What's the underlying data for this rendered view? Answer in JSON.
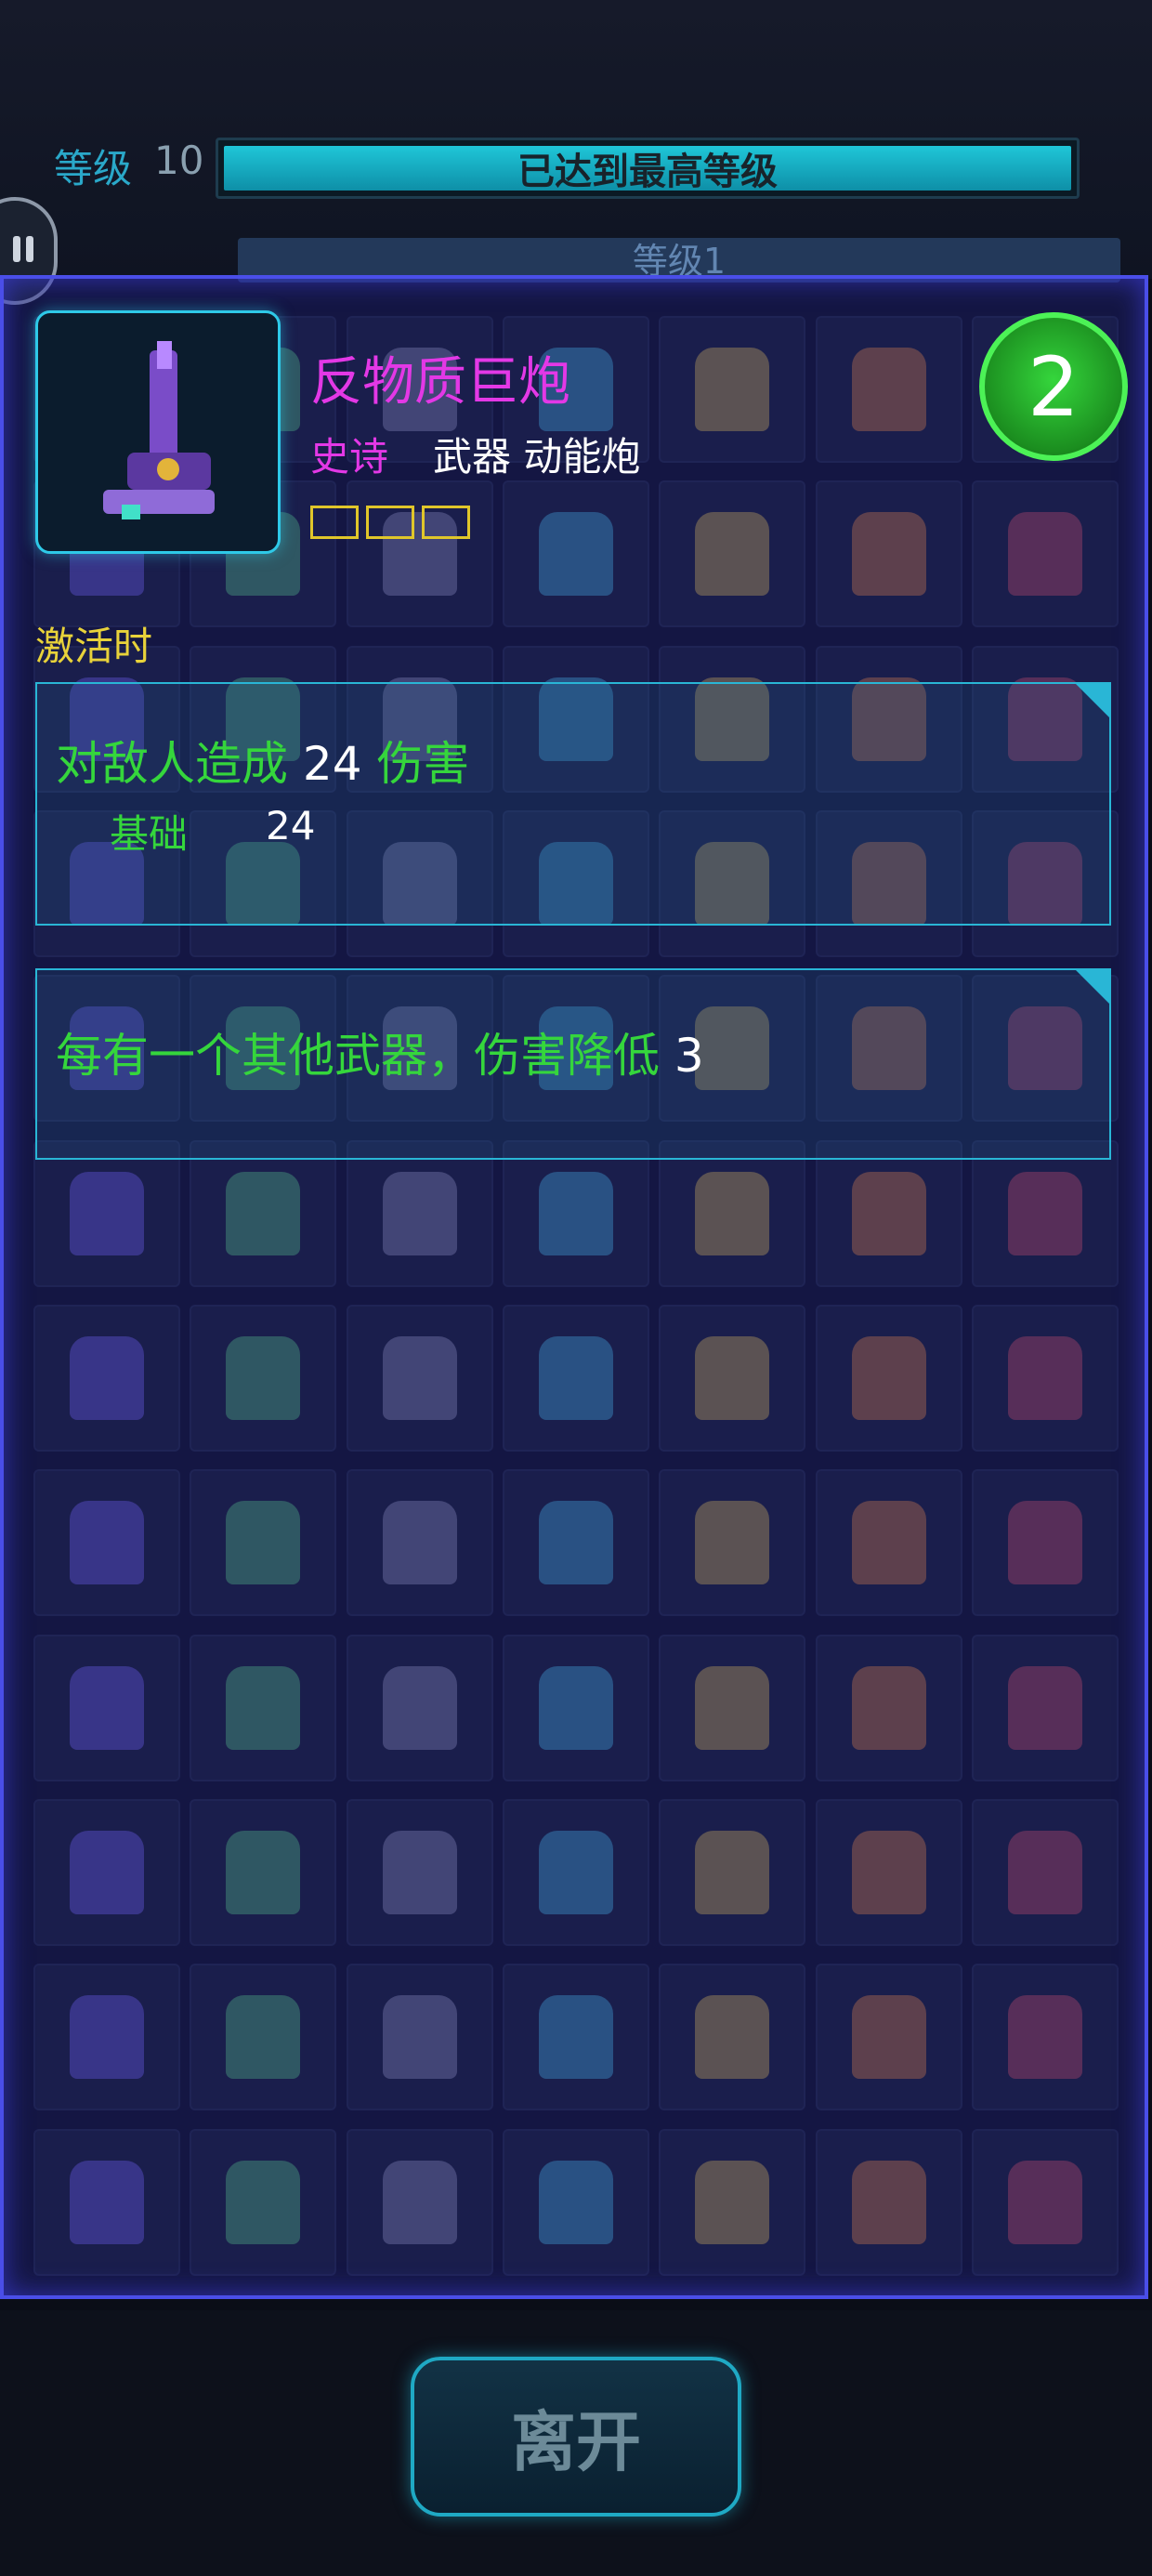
{
  "header": {
    "level_label": "等级",
    "level_value": "10",
    "level_bar_text": "已达到最高等级",
    "level_fill_fraction": 1,
    "sublevel_text": "等级1"
  },
  "item": {
    "name": "反物质巨炮",
    "rarity": "史诗",
    "type": "武器 动能炮",
    "slots": 3,
    "level_circle_value": "2"
  },
  "activation": {
    "label": "激活时",
    "effect1": {
      "prefix": "对敌人造成",
      "value": "24",
      "suffix": "伤害",
      "base_label": "基础",
      "base_value": "24"
    },
    "effect2": {
      "text": "每有一个其他武器，伤害降低",
      "value": "3"
    }
  },
  "footer": {
    "leave_button": "离开"
  },
  "colors": {
    "accent_cyan": "#29b6d6",
    "epic_magenta": "#e338e6",
    "green_text": "#35d63c",
    "activation_yellow": "#e8d23a",
    "panel_border": "#4a4ee8"
  }
}
